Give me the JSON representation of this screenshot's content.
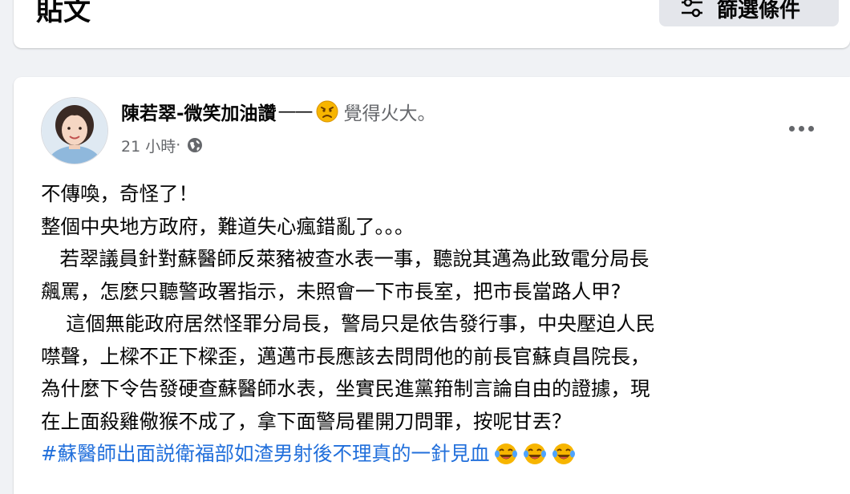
{
  "filter_bar": {
    "title": "貼文",
    "filter_button_label": "篩選條件",
    "filter_icon": "sliders-icon"
  },
  "post": {
    "author": "陳若翠-微笑加油讚",
    "feeling_separator": "——",
    "feeling_emoji": "angry-face-emoji",
    "feeling_text": "覺得火大。",
    "timestamp": "21 小時",
    "meta_separator": " · ",
    "audience_icon": "globe-icon",
    "more_icon": "more-horizontal-icon",
    "lines": [
      "不傳喚，奇怪了！",
      "整個中央地方政府，難道失心瘋錯亂了。。。",
      "   若翠議員針對蘇醫師反萊豬被查水表一事，聽說其邁為此致電分局長",
      "飆罵，怎麼只聽警政署指示，未照會一下市長室，把市長當路人甲?",
      "    這個無能政府居然怪罪分局長，警局只是依告發行事，中央壓迫人民",
      "噤聲，上樑不正下樑歪，邁邁市長應該去問問他的前長官蘇貞昌院長，",
      "為什麼下令告發硬查蘇醫師水表，坐實民進黨箝制言論自由的證據，現",
      "在上面殺雞儆猴不成了，拿下面警局瞿開刀問罪，按呢甘丟？"
    ],
    "hashtag": "#蘇醫師出面説衛福部如渣男射後不理真的一針見血",
    "hashtag_emojis": [
      "laughing-crying-emoji",
      "laughing-crying-emoji",
      "laughing-crying-emoji"
    ],
    "colors": {
      "hashtag": "#216fdb",
      "secondary_text": "#65676b",
      "background": "#f0f2f5"
    }
  }
}
